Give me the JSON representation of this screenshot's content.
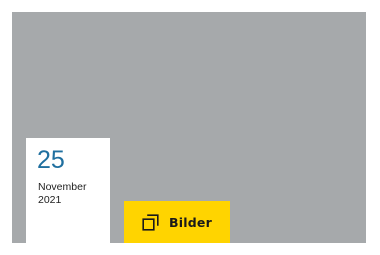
{
  "card": {
    "date": {
      "day": "25",
      "month": "November",
      "year": "2021"
    },
    "gallery_button": {
      "label": "Bilder",
      "icon": "gallery-copy-icon"
    },
    "colors": {
      "image_placeholder": "#a6a9ab",
      "accent": "#ffd400",
      "day_text": "#1f6f9f"
    }
  }
}
